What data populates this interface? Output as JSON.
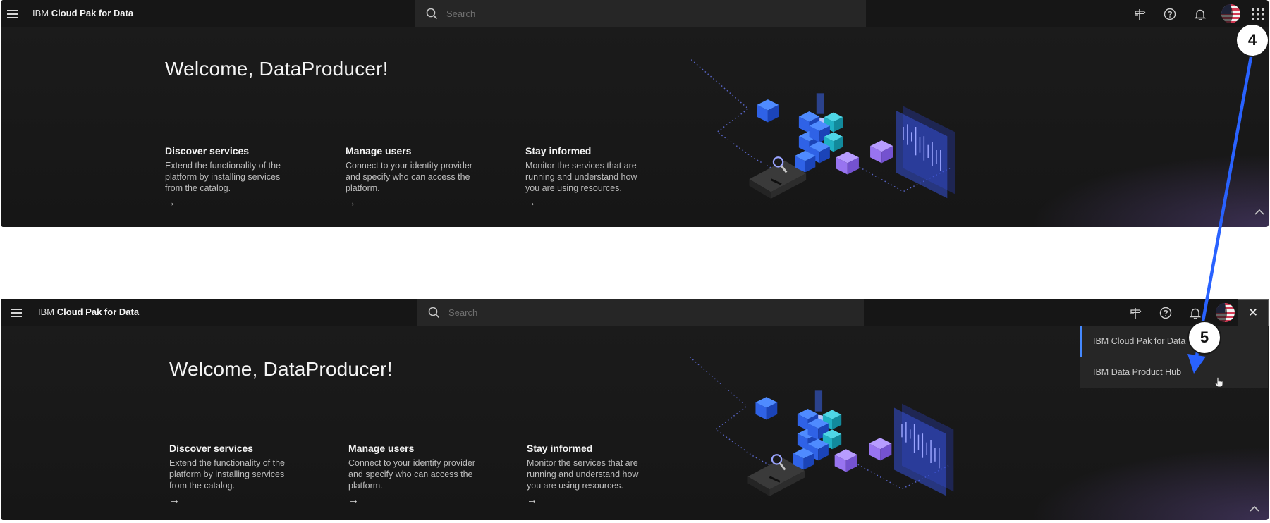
{
  "app": {
    "brand_prefix": "IBM",
    "brand_name": "Cloud Pak for Data"
  },
  "search": {
    "placeholder": "Search"
  },
  "toolbar": {
    "icons": [
      "signpost-icon",
      "help-icon",
      "notification-icon",
      "avatar",
      "app-switcher-icon"
    ]
  },
  "hero": {
    "welcome": "Welcome, DataProducer!",
    "cards": [
      {
        "title": "Discover services",
        "body": "Extend the functionality of the platform by installing services from the catalog.",
        "arrow": "→"
      },
      {
        "title": "Manage users",
        "body": "Connect to your identity provider and specify who can access the platform.",
        "arrow": "→"
      },
      {
        "title": "Stay informed",
        "body": "Monitor the services that are running and understand how you are using resources.",
        "arrow": "→"
      }
    ]
  },
  "switcher": {
    "close_label": "✕",
    "items": [
      {
        "label": "IBM Cloud Pak for Data",
        "active": true
      },
      {
        "label": "IBM Data Product Hub",
        "active": false
      }
    ]
  },
  "annotations": {
    "step_a": "4",
    "step_b": "5",
    "arrow_color": "#2962ff"
  },
  "colors": {
    "background": "#171717",
    "topbar": "#161616",
    "accent": "#4589ff",
    "text": "#f4f4f4"
  }
}
